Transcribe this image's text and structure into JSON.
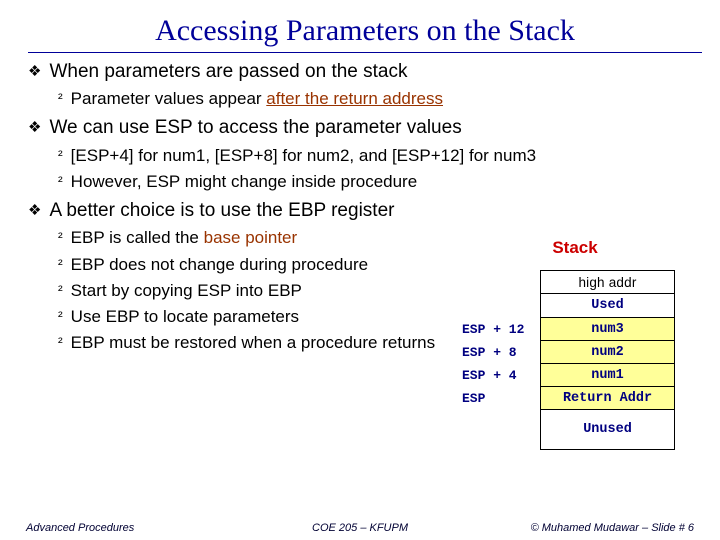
{
  "title": "Accessing Parameters on the Stack",
  "bullets": {
    "b1_1": "When parameters are passed on the stack",
    "b2_1a": "Parameter values appear ",
    "b2_1b": "after the return address",
    "b1_2": "We can use ESP to access the parameter values",
    "b2_2": "[ESP+4] for num1, [ESP+8] for num2, and [ESP+12] for num3",
    "b2_3": "However, ESP might change inside procedure",
    "b1_3": "A better choice is to use the EBP register",
    "b2_4a": "EBP is called the ",
    "b2_4b": "base pointer",
    "b2_5": "EBP does not change during procedure",
    "b2_6": "Start by copying ESP into EBP",
    "b2_7": "Use EBP to locate parameters",
    "b2_8": "EBP must be restored when a procedure returns"
  },
  "stack": {
    "title": "Stack",
    "high": "high addr",
    "used": "Used",
    "rows": [
      {
        "label": "ESP + 12",
        "value": "num3"
      },
      {
        "label": "ESP + 8",
        "value": "num2"
      },
      {
        "label": "ESP + 4",
        "value": "num1"
      },
      {
        "label": "ESP",
        "value": "Return Addr"
      }
    ],
    "unused": "Unused"
  },
  "footer": {
    "left": "Advanced Procedures",
    "center": "COE 205 – KFUPM",
    "right": "© Muhamed Mudawar – Slide # 6"
  }
}
